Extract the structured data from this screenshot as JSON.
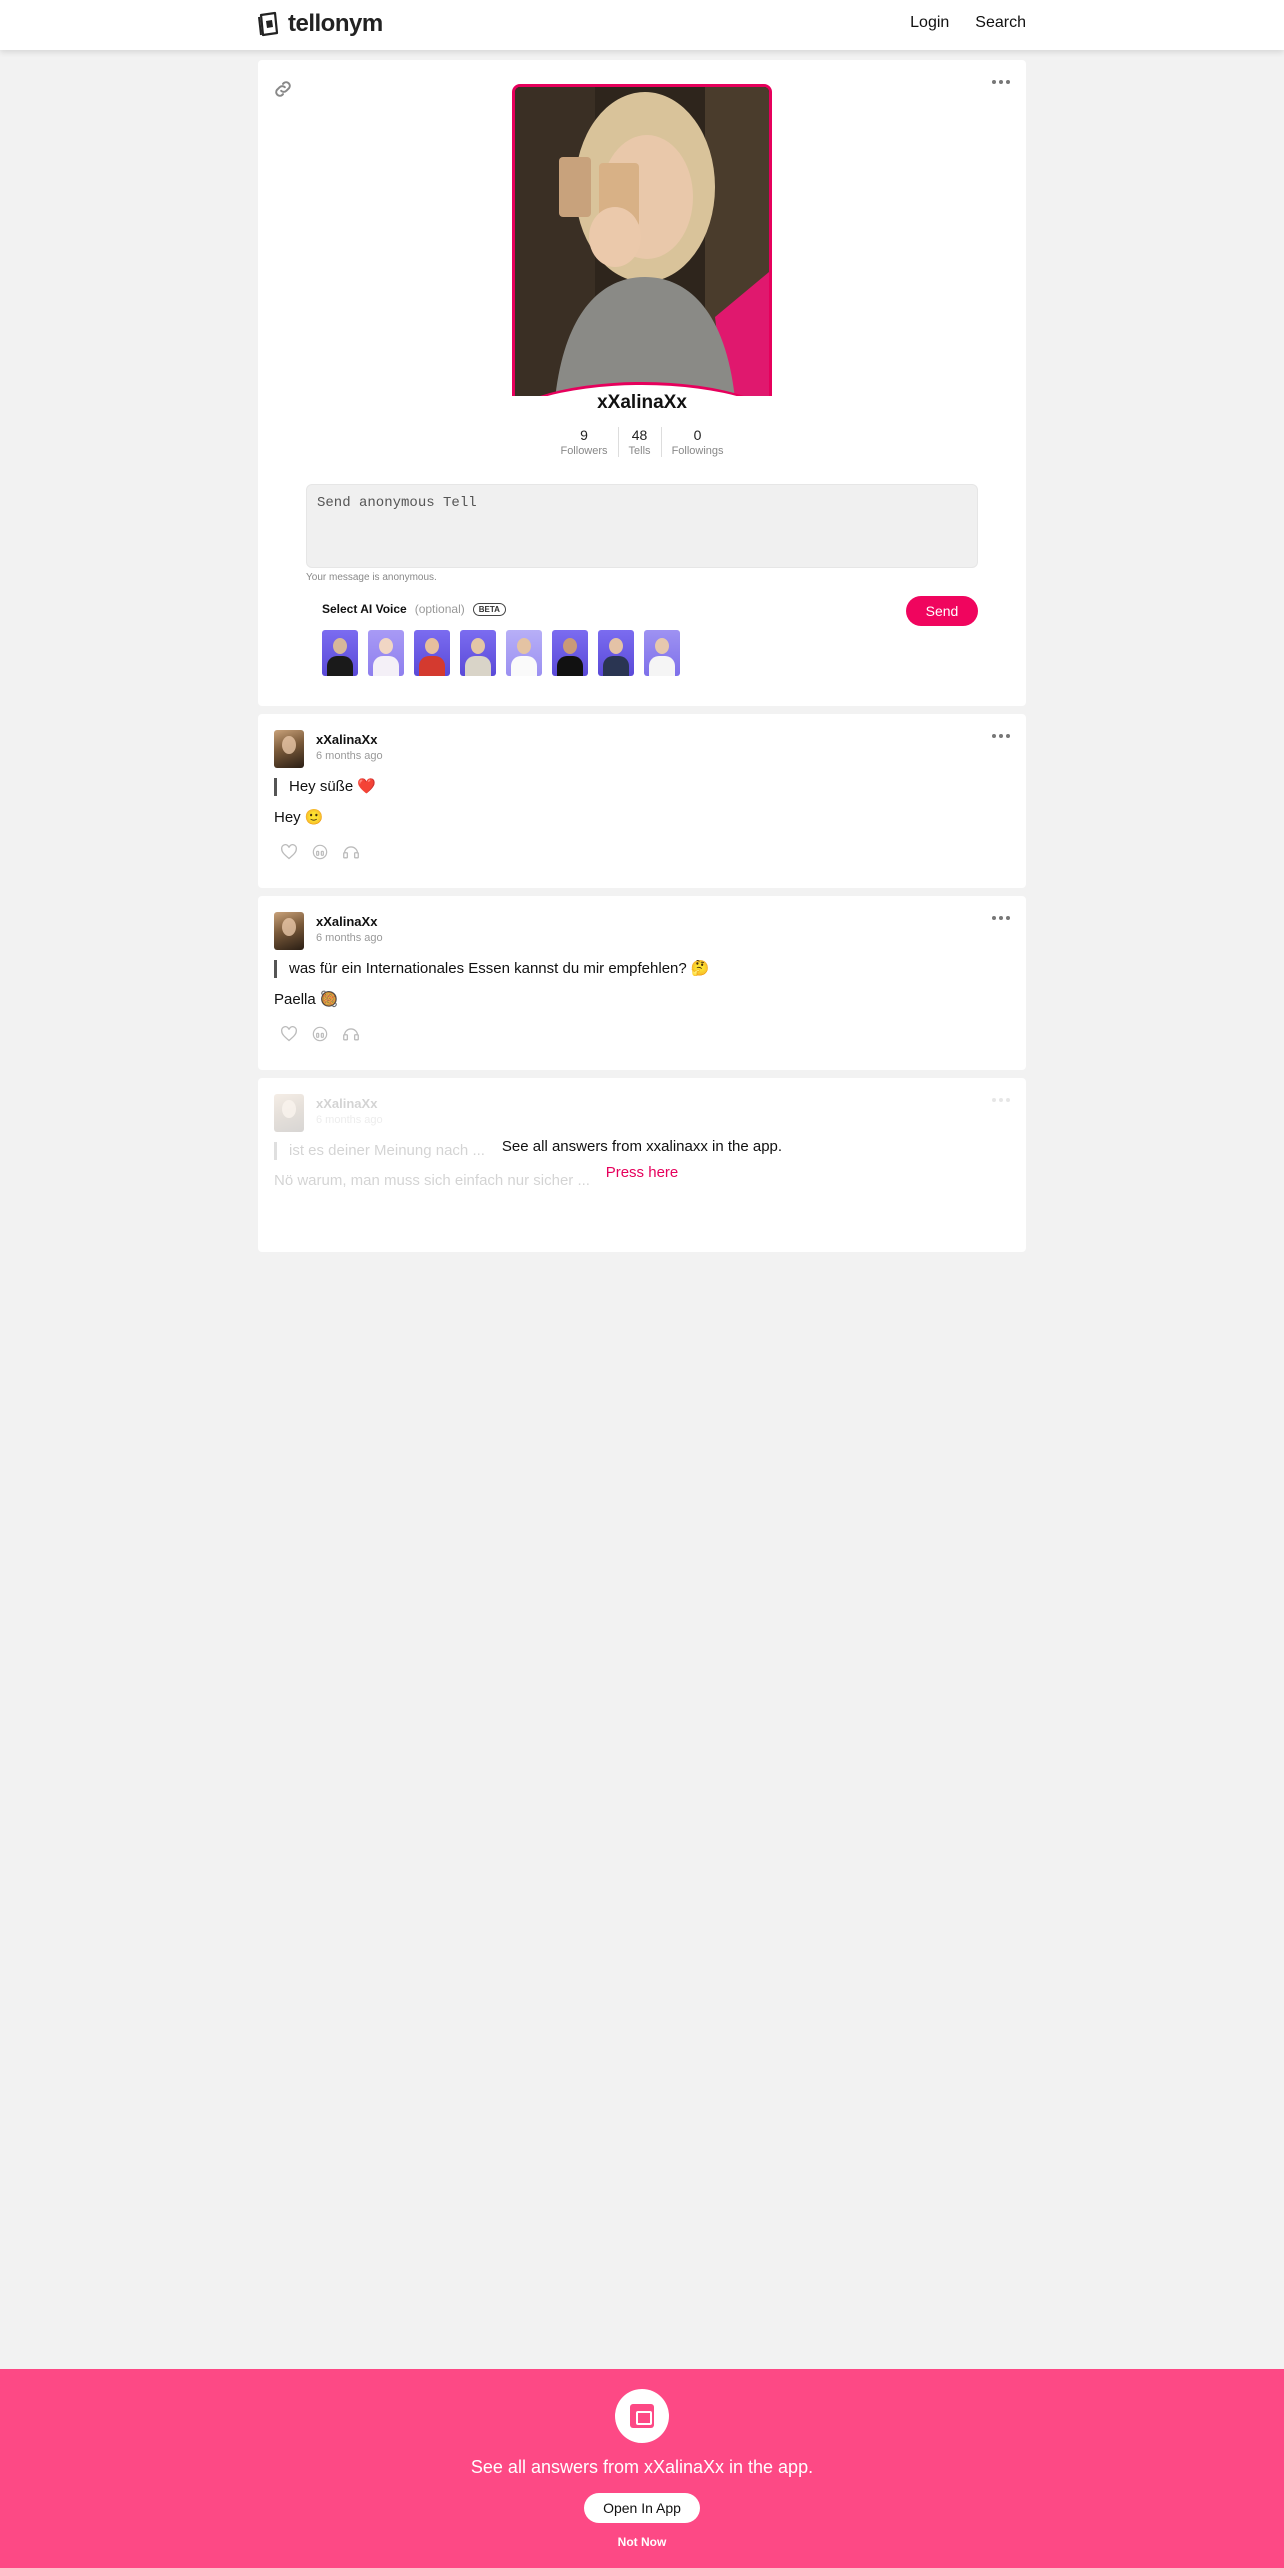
{
  "header": {
    "brand": "tellonym",
    "nav": {
      "login": "Login",
      "search": "Search"
    }
  },
  "profile": {
    "username": "xXalinaXx",
    "stats": [
      {
        "value": "9",
        "label": "Followers"
      },
      {
        "value": "48",
        "label": "Tells"
      },
      {
        "value": "0",
        "label": "Followings"
      }
    ],
    "tell_placeholder": "Send anonymous Tell",
    "anon_note": "Your message is anonymous.",
    "ai_voice_title": "Select AI Voice",
    "ai_voice_optional": "(optional)",
    "beta_badge": "BETA",
    "send_label": "Send",
    "voice_count": 8
  },
  "answers": [
    {
      "user": "xXalinaXx",
      "time": "6 months ago",
      "question": "Hey süße ❤️",
      "answer": "Hey 🙂"
    },
    {
      "user": "xXalinaXx",
      "time": "6 months ago",
      "question": "was für ein Internationales Essen kannst du mir empfehlen? 🤔",
      "answer": "Paella 🥘"
    },
    {
      "user": "xXalinaXx",
      "time": "6 months ago",
      "question": "ist es deiner Meinung nach ...",
      "answer": "Nö warum, man muss sich einfach nur sicher ..."
    }
  ],
  "locked": {
    "message": "See all answers from xxalinaxx in the app.",
    "action": "Press here"
  },
  "banner": {
    "message": "See all answers from xXalinaXx in the app.",
    "open_label": "Open In App",
    "dismiss_label": "Not Now"
  },
  "colors": {
    "accent": "#f0055e",
    "banner_bg": "#fd4985"
  }
}
